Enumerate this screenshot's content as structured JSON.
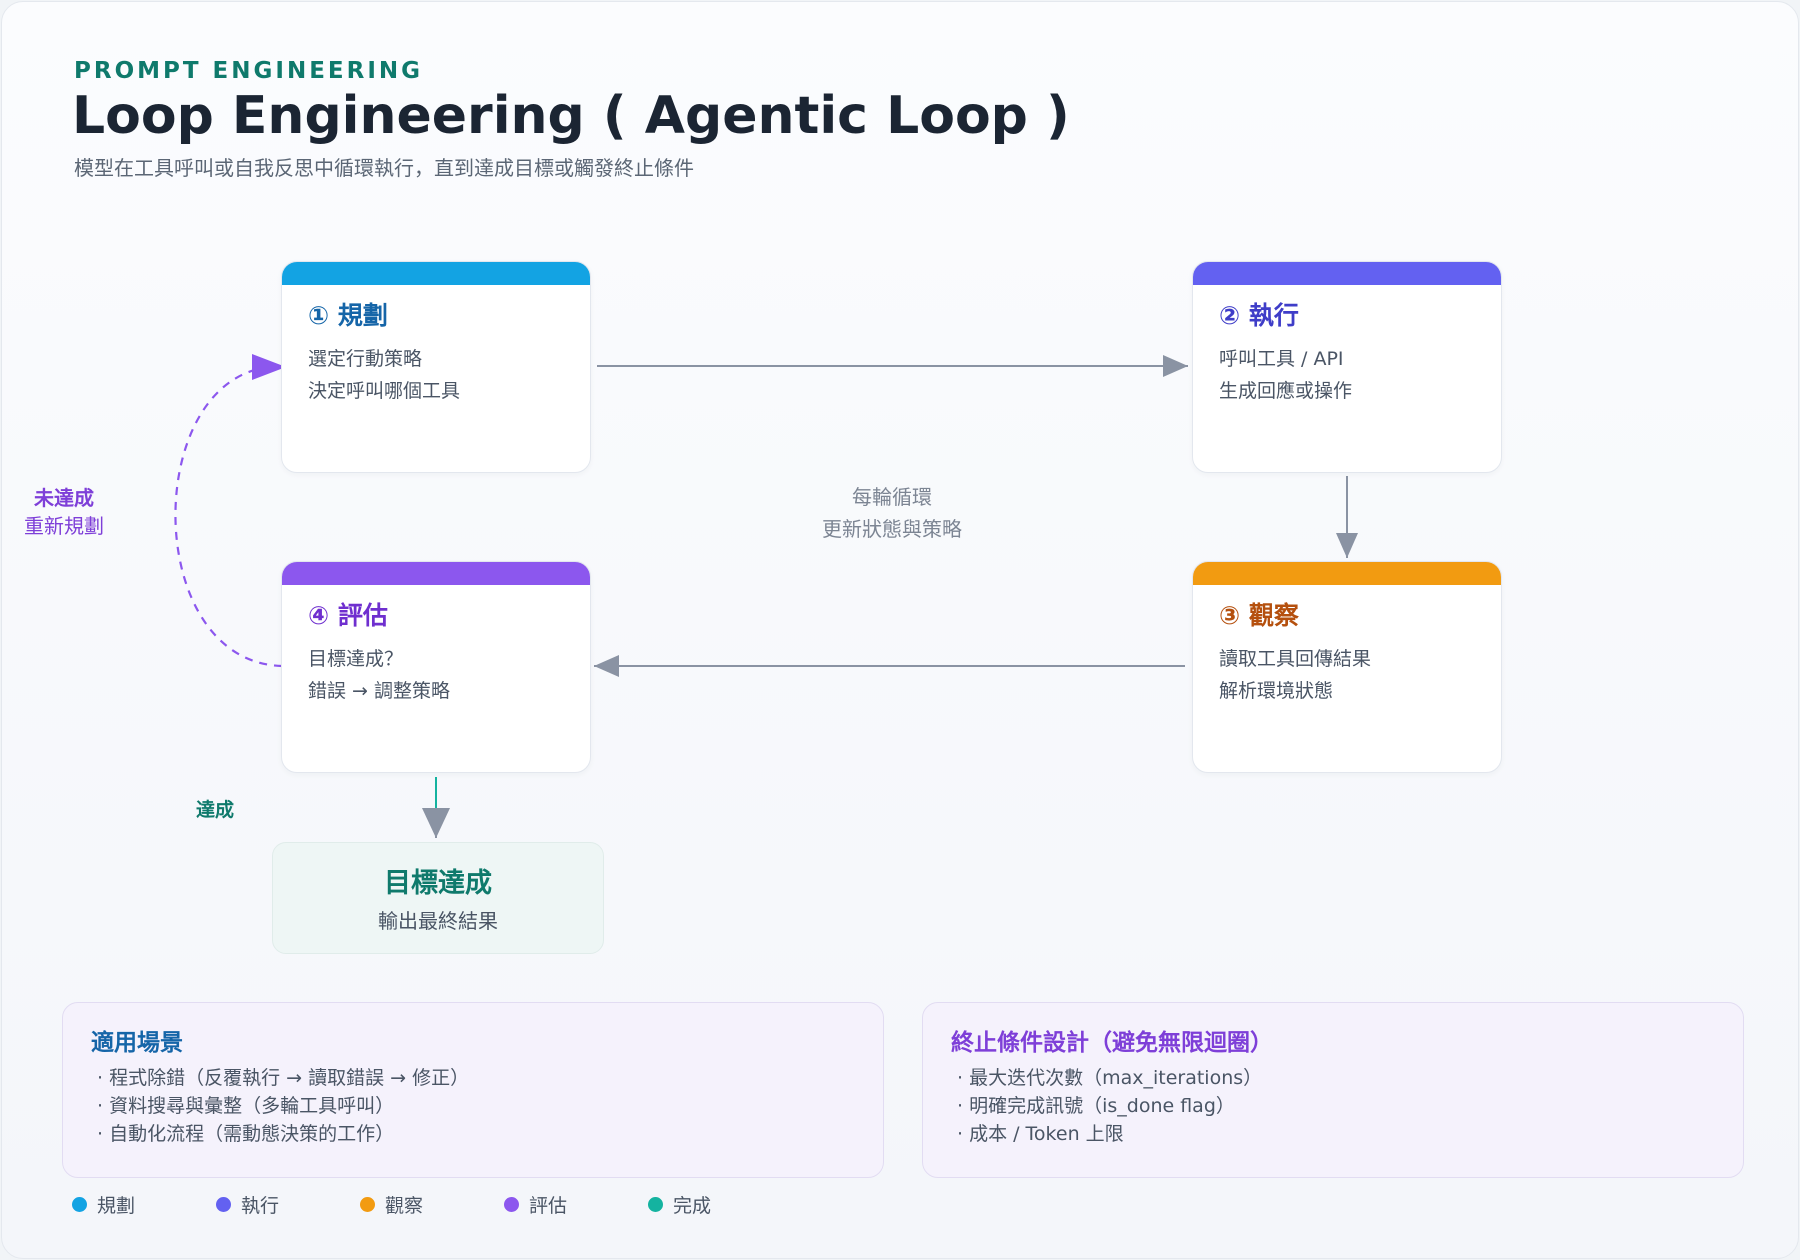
{
  "header": {
    "eyebrow": "PROMPT ENGINEERING",
    "title": "Loop Engineering ( Agentic Loop )",
    "subtitle": "模型在工具呼叫或自我反思中循環執行，直到達成目標或觸發終止條件"
  },
  "colors": {
    "plan": "#13a3e3",
    "execute": "#6361f1",
    "observe": "#f29b11",
    "evaluate": "#8c57ee",
    "done": "#14b3a0",
    "arrow": "#8a93a3",
    "retry": "#8c57ee"
  },
  "steps": [
    {
      "title": "① 規劃",
      "lines": [
        "選定行動策略",
        "決定呼叫哪個工具"
      ]
    },
    {
      "title": "② 執行",
      "lines": [
        "呼叫工具 / API",
        "生成回應或操作"
      ]
    },
    {
      "title": "③ 觀察",
      "lines": [
        "讀取工具回傳結果",
        "解析環境狀態"
      ]
    },
    {
      "title": "④ 評估",
      "lines": [
        "目標達成？",
        "錯誤 → 調整策略"
      ]
    }
  ],
  "center_note": [
    "每輪循環",
    "更新狀態與策略"
  ],
  "retry_label": {
    "title": "未達成",
    "subtitle": "重新規劃"
  },
  "done_label": "達成",
  "goal": {
    "title": "目標達成",
    "subtitle": "輸出最終結果"
  },
  "panels": {
    "use_cases": {
      "title": "適用場景",
      "items": [
        "· 程式除錯（反覆執行 → 讀取錯誤 → 修正）",
        "· 資料搜尋與彙整（多輪工具呼叫）",
        "· 自動化流程（需動態決策的工作）"
      ]
    },
    "termination": {
      "title": "終止條件設計（避免無限迴圈）",
      "items": [
        "· 最大迭代次數（max_iterations）",
        "· 明確完成訊號（is_done flag）",
        "· 成本 / Token 上限"
      ]
    }
  },
  "legend": [
    {
      "label": "規劃",
      "color": "#13a3e3"
    },
    {
      "label": "執行",
      "color": "#6361f1"
    },
    {
      "label": "觀察",
      "color": "#f29b11"
    },
    {
      "label": "評估",
      "color": "#8c57ee"
    },
    {
      "label": "完成",
      "color": "#14b3a0"
    }
  ]
}
